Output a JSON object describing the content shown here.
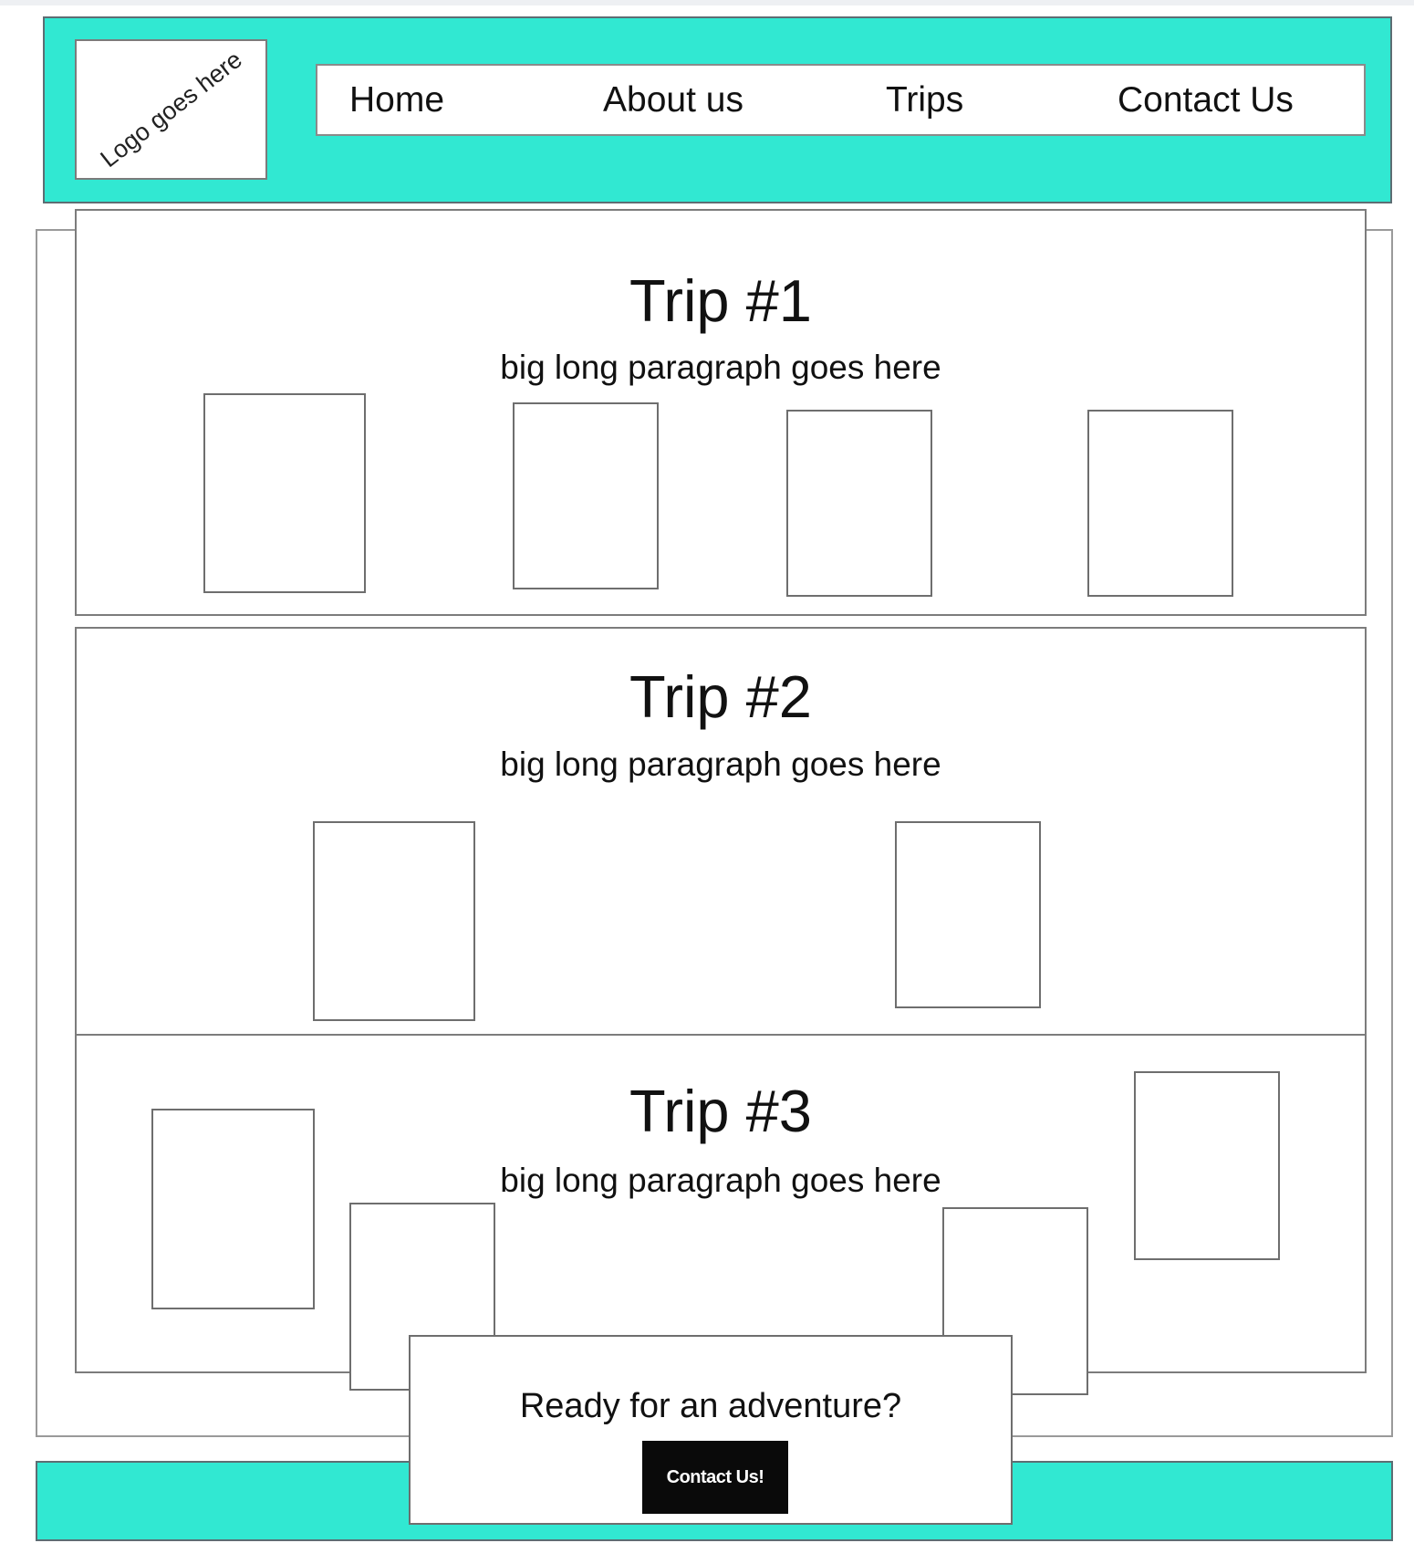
{
  "header": {
    "logo_text": "Logo goes here",
    "nav": [
      {
        "label": "Home"
      },
      {
        "label": "About us"
      },
      {
        "label": "Trips"
      },
      {
        "label": "Contact Us"
      }
    ]
  },
  "trips": [
    {
      "title": "Trip #1",
      "paragraph": "big long paragraph goes here"
    },
    {
      "title": "Trip #2",
      "paragraph": "big long paragraph goes here"
    },
    {
      "title": "Trip #3",
      "paragraph": "big long paragraph goes here"
    }
  ],
  "cta": {
    "text": "Ready for an adventure?",
    "button_label": "Contact Us!"
  },
  "colors": {
    "accent": "#31e8d2",
    "button_bg": "#0a0a0a",
    "border": "#7c7c7c"
  }
}
